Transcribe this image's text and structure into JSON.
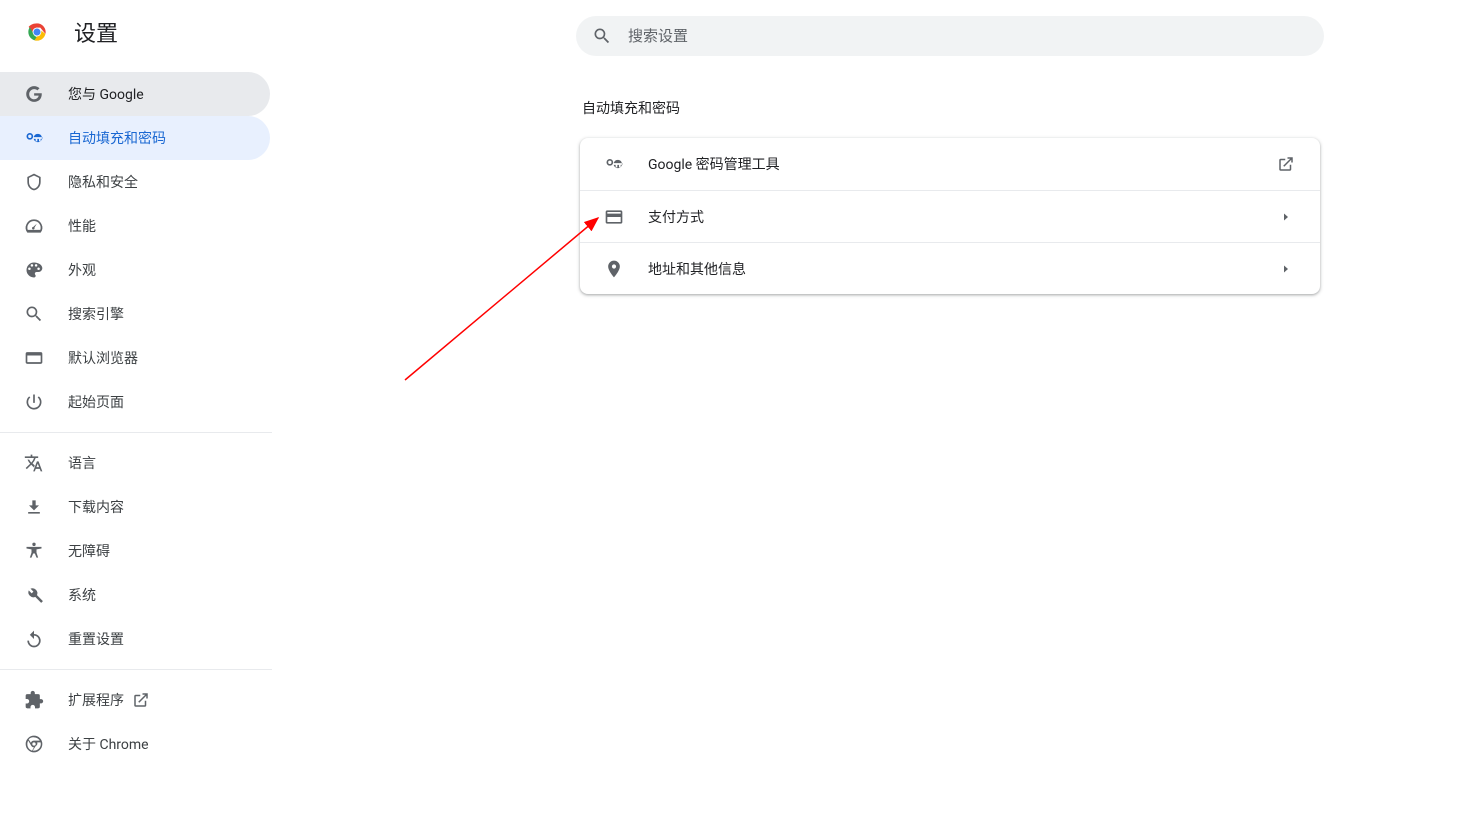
{
  "header": {
    "title": "设置"
  },
  "search": {
    "placeholder": "搜索设置"
  },
  "sidebar": {
    "groups": [
      [
        {
          "id": "you-google",
          "label": "您与 Google"
        },
        {
          "id": "autofill",
          "label": "自动填充和密码"
        },
        {
          "id": "privacy",
          "label": "隐私和安全"
        },
        {
          "id": "performance",
          "label": "性能"
        },
        {
          "id": "appearance",
          "label": "外观"
        },
        {
          "id": "search-engine",
          "label": "搜索引擎"
        },
        {
          "id": "default-browser",
          "label": "默认浏览器"
        },
        {
          "id": "on-startup",
          "label": "起始页面"
        }
      ],
      [
        {
          "id": "languages",
          "label": "语言"
        },
        {
          "id": "downloads",
          "label": "下载内容"
        },
        {
          "id": "accessibility",
          "label": "无障碍"
        },
        {
          "id": "system",
          "label": "系统"
        },
        {
          "id": "reset",
          "label": "重置设置"
        }
      ],
      [
        {
          "id": "extensions",
          "label": "扩展程序"
        },
        {
          "id": "about-chrome",
          "label": "关于 Chrome"
        }
      ]
    ]
  },
  "main": {
    "section_title": "自动填充和密码",
    "rows": [
      {
        "id": "password-manager",
        "label": "Google 密码管理工具",
        "trail": "open-external"
      },
      {
        "id": "payment-methods",
        "label": "支付方式",
        "trail": "chevron"
      },
      {
        "id": "addresses",
        "label": "地址和其他信息",
        "trail": "chevron"
      }
    ]
  }
}
